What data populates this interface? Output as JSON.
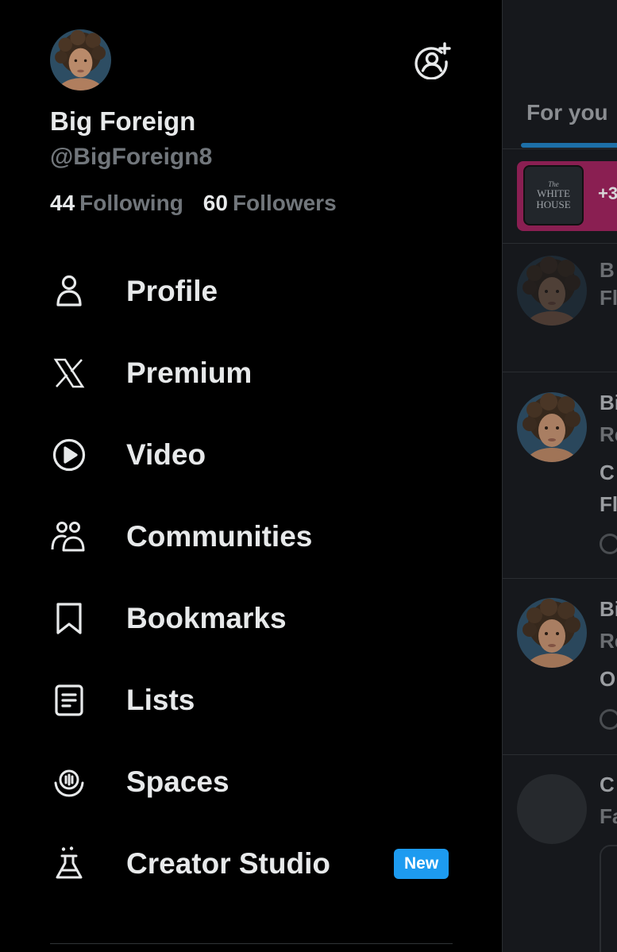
{
  "user": {
    "display_name": "Big Foreign",
    "handle": "@BigForeign8",
    "following_count": "44",
    "following_label": "Following",
    "followers_count": "60",
    "followers_label": "Followers"
  },
  "nav": {
    "items": [
      {
        "label": "Profile",
        "icon": "person-icon"
      },
      {
        "label": "Premium",
        "icon": "x-logo-icon"
      },
      {
        "label": "Video",
        "icon": "play-circle-icon"
      },
      {
        "label": "Communities",
        "icon": "communities-icon"
      },
      {
        "label": "Bookmarks",
        "icon": "bookmark-icon"
      },
      {
        "label": "Lists",
        "icon": "list-icon"
      },
      {
        "label": "Spaces",
        "icon": "spaces-icon"
      },
      {
        "label": "Creator Studio",
        "icon": "flask-icon",
        "badge": "New"
      }
    ]
  },
  "timeline": {
    "tab_label": "For you",
    "space_card": {
      "title_small": "The",
      "title_big": "WHITE HOUSE",
      "count": "+3"
    }
  },
  "colors": {
    "background": "#000000",
    "text_primary": "#e7e9ea",
    "text_secondary": "#71767b",
    "accent": "#1d9bf0",
    "space_card": "#8a1f52"
  }
}
